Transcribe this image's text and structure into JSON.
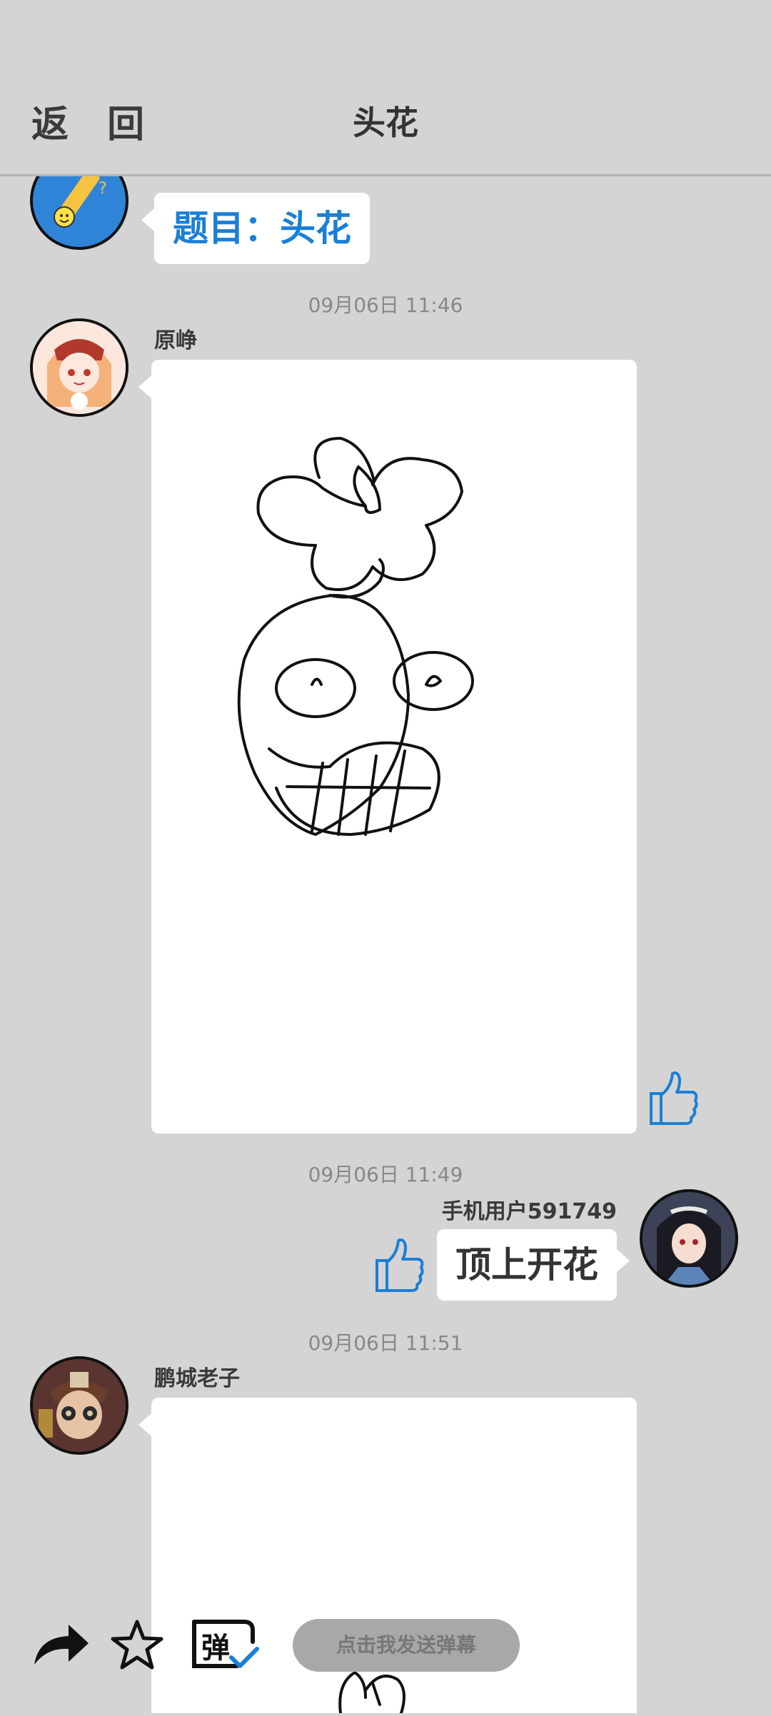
{
  "header": {
    "back_label": "返 回",
    "title": "头花"
  },
  "messages": [
    {
      "name": "",
      "text": "题目：头花"
    },
    {
      "time": "09月06日  11:46",
      "name": "原峥"
    },
    {
      "time": "09月06日  11:49",
      "name": "手机用户591749",
      "text": "顶上开花"
    },
    {
      "time": "09月06日  11:51",
      "name": "鹏城老子"
    }
  ],
  "bottom": {
    "danmu_placeholder": "点击我发送弹幕",
    "danmu_icon_glyph": "弹"
  },
  "colors": {
    "accent": "#1a7fd6",
    "background": "#d4d4d4"
  }
}
